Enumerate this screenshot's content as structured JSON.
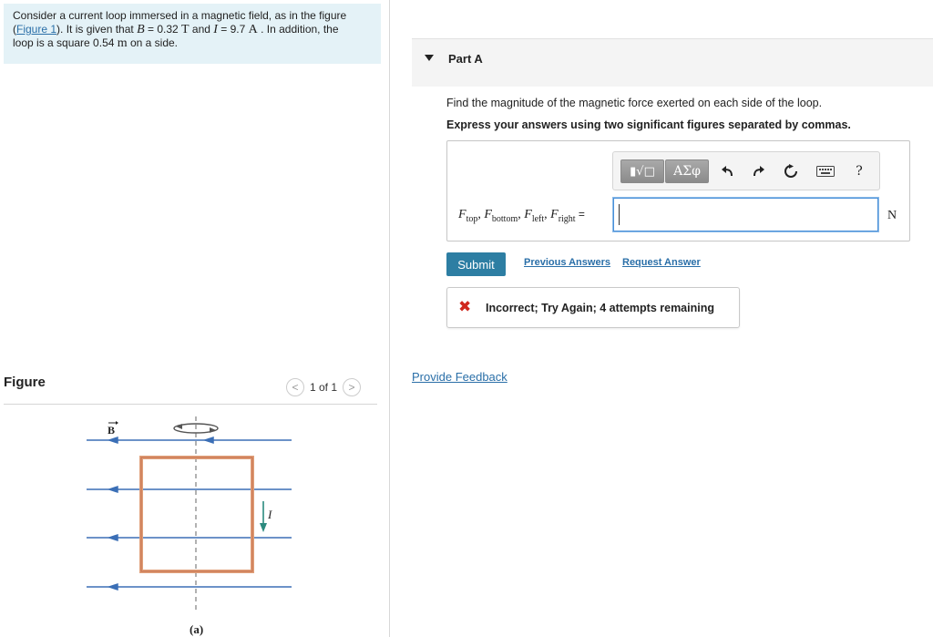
{
  "problem": {
    "line1": "Consider a current loop immersed in a magnetic field, as in the figure",
    "paren_open": "(",
    "figure_link": "Figure 1",
    "after_link": "). It is given that ",
    "B_var": "B",
    "B_eq": " = 0.32 ",
    "B_unit": "T",
    "and_text": " and ",
    "I_var": "I",
    "I_eq": " = 9.7 ",
    "I_unit": "A",
    "after_I": " . In addition, the",
    "line3_pre": "loop is a square 0.54 ",
    "side_unit": "m",
    "line3_post": " on a side."
  },
  "figure_panel": {
    "title": "Figure",
    "pager_text": "1 of 1",
    "prev_symbol": "<",
    "next_symbol": ">",
    "label_B": "B",
    "label_I": "I",
    "caption": "(a)"
  },
  "part": {
    "label": "Part A",
    "question": "Find the magnitude of the magnetic force exerted on each side of the loop.",
    "instruction": "Express your answers using two significant figures separated by commas."
  },
  "toolbar": {
    "templates_label": "▮√□",
    "greek_label": "ΑΣφ",
    "help_label": "?"
  },
  "equation": {
    "F": "F",
    "top": "top",
    "bottom": "bottom",
    "left": "left",
    "right": "right",
    "sep": ", ",
    "equals": " ="
  },
  "answer": {
    "value": "",
    "unit": "N"
  },
  "actions": {
    "submit": "Submit",
    "previous_answers": "Previous Answers",
    "request_answer": "Request Answer"
  },
  "feedback": {
    "icon": "✖",
    "message": "Incorrect; Try Again; 4 attempts remaining"
  },
  "footer": {
    "provide_feedback": "Provide Feedback"
  },
  "colors": {
    "accent": "#2d7ea3",
    "link": "#2a6fa8",
    "error": "#d0281e",
    "field_line": "#3b6fb6",
    "loop": "#e0a07a",
    "current_arrow": "#2b8a7e"
  }
}
